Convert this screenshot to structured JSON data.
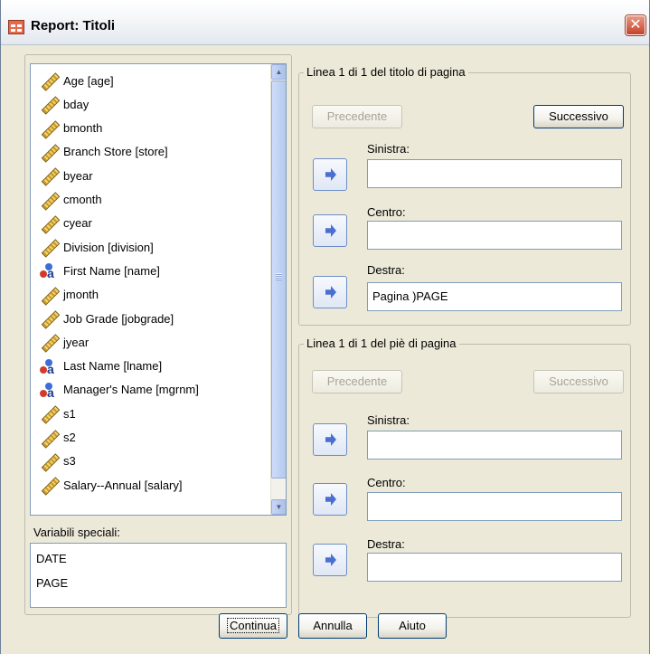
{
  "window": {
    "title": "Report: Titoli",
    "close_glyph": "✕"
  },
  "variables": {
    "items": [
      {
        "label": "Age [age]",
        "icon": "ruler-icon"
      },
      {
        "label": "bday",
        "icon": "ruler-icon"
      },
      {
        "label": "bmonth",
        "icon": "ruler-icon"
      },
      {
        "label": "Branch Store [store]",
        "icon": "ruler-icon"
      },
      {
        "label": "byear",
        "icon": "ruler-icon"
      },
      {
        "label": "cmonth",
        "icon": "ruler-icon"
      },
      {
        "label": "cyear",
        "icon": "ruler-icon"
      },
      {
        "label": "Division [division]",
        "icon": "ruler-icon"
      },
      {
        "label": "First Name [name]",
        "icon": "nominal-icon"
      },
      {
        "label": "jmonth",
        "icon": "ruler-icon"
      },
      {
        "label": "Job Grade [jobgrade]",
        "icon": "ruler-icon"
      },
      {
        "label": "jyear",
        "icon": "ruler-icon"
      },
      {
        "label": "Last Name [lname]",
        "icon": "nominal-icon"
      },
      {
        "label": "Manager's Name [mgrnm]",
        "icon": "nominal-icon"
      },
      {
        "label": "s1",
        "icon": "ruler-icon"
      },
      {
        "label": "s2",
        "icon": "ruler-icon"
      },
      {
        "label": "s3",
        "icon": "ruler-icon"
      },
      {
        "label": "Salary--Annual [salary]",
        "icon": "ruler-icon"
      }
    ]
  },
  "special": {
    "label": "Variabili speciali:",
    "items": [
      "DATE",
      "PAGE"
    ]
  },
  "page_title": {
    "group_label": "Linea 1 di 1 del titolo di pagina",
    "prev_label": "Precedente",
    "next_label": "Successivo",
    "left_label": "Sinistra:",
    "center_label": "Centro:",
    "right_label": "Destra:",
    "left_value": "",
    "center_value": "",
    "right_value": "Pagina )PAGE"
  },
  "footer": {
    "group_label": "Linea 1 di 1 del piè di pagina",
    "prev_label": "Precedente",
    "next_label": "Successivo",
    "left_label": "Sinistra:",
    "center_label": "Centro:",
    "right_label": "Destra:",
    "left_value": "",
    "center_value": "",
    "right_value": ""
  },
  "buttons": {
    "continue": "Continua",
    "cancel": "Annulla",
    "help": "Aiuto"
  }
}
